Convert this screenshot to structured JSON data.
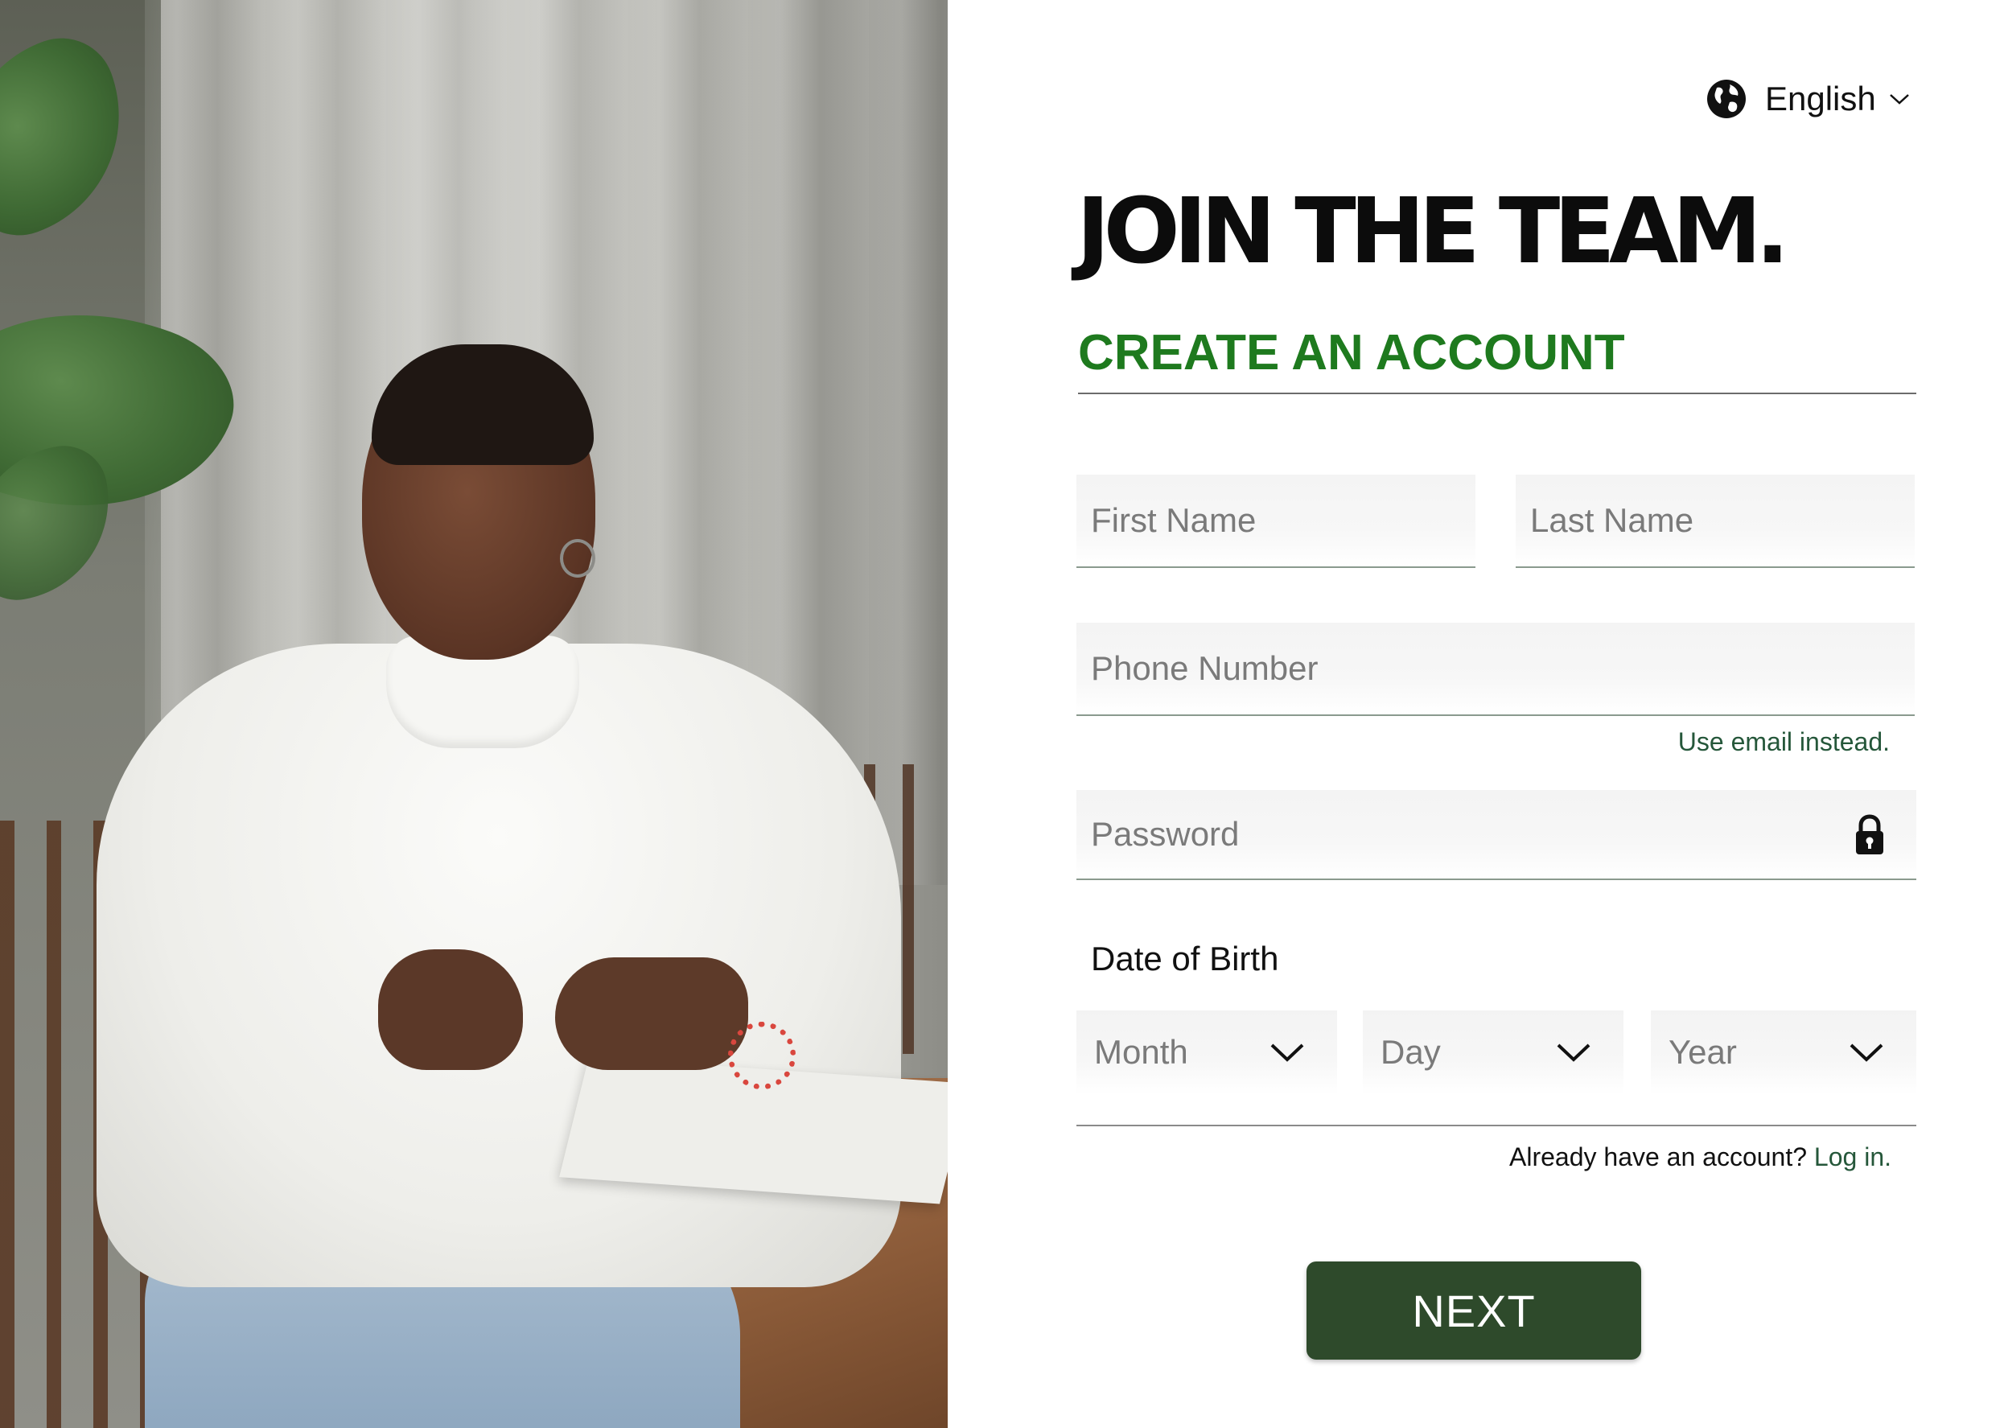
{
  "language": {
    "label": "English",
    "icon": "globe-icon"
  },
  "heading": {
    "title": "JOIN THE TEAM.",
    "subtitle": "CREATE AN ACCOUNT"
  },
  "form": {
    "first_name": {
      "placeholder": "First Name",
      "value": ""
    },
    "last_name": {
      "placeholder": "Last Name",
      "value": ""
    },
    "phone": {
      "placeholder": "Phone Number",
      "value": ""
    },
    "use_email_link": "Use email instead.",
    "password": {
      "placeholder": "Password",
      "value": "",
      "icon": "lock-icon"
    },
    "dob": {
      "label": "Date of Birth",
      "month": "Month",
      "day": "Day",
      "year": "Year"
    },
    "login_prompt": "Already have an account?",
    "login_link": "Log in.",
    "next_button": "NEXT"
  },
  "colors": {
    "accent_green": "#1e7a1e",
    "link_green": "#25573a",
    "button_bg": "#2e4a2b",
    "title": "#0c0c0c"
  }
}
